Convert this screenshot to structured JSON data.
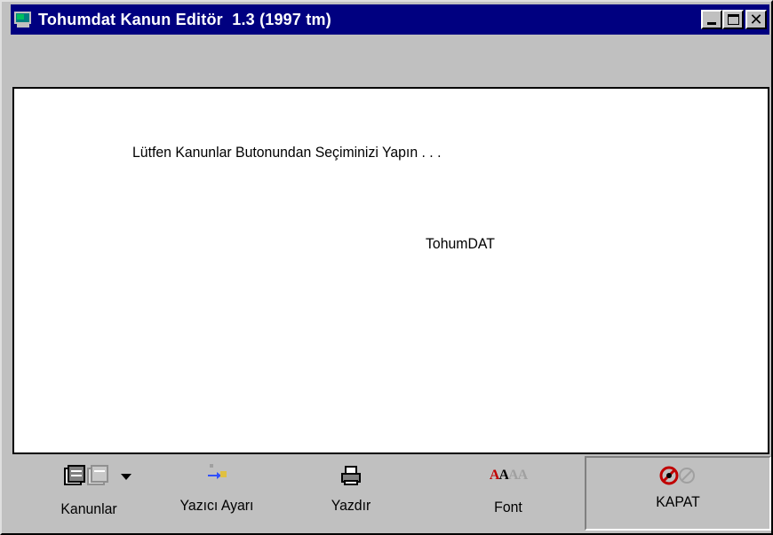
{
  "window": {
    "title": "Tohumdat Kanun Editör  1.3 (1997 tm)"
  },
  "title_buttons": {
    "minimize": "minimize",
    "maximize": "maximize",
    "close": "✕"
  },
  "content": {
    "prompt": "Lütfen Kanunlar Butonundan Seçiminizi Yapın . . .",
    "brand": "TohumDAT"
  },
  "toolbar": {
    "kanunlar_label": "Kanunlar",
    "yazici_label": "Yazıcı Ayarı",
    "yazdir_label": "Yazdır",
    "font_label": "Font",
    "kapat_label": "KAPAT"
  },
  "icons": {
    "kanunlar": "books-icon",
    "yazici": "printer-settings-icon",
    "yazdir": "printer-icon",
    "font": "font-icon",
    "kapat": "close-app-icon"
  },
  "colors": {
    "titlebar": "#000080",
    "face": "#c0c0c0",
    "content_bg": "#ffffff"
  }
}
